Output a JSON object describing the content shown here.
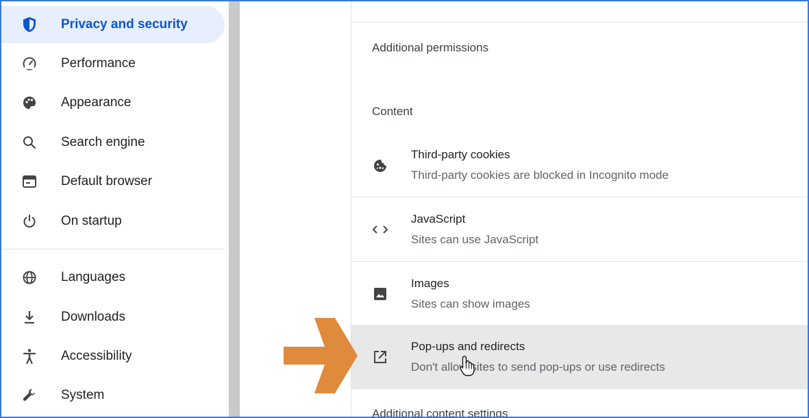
{
  "sidebar": {
    "items": [
      {
        "label": "Privacy and security",
        "icon": "shield-icon",
        "active": true
      },
      {
        "label": "Performance",
        "icon": "speedometer-icon"
      },
      {
        "label": "Appearance",
        "icon": "palette-icon"
      },
      {
        "label": "Search engine",
        "icon": "search-icon"
      },
      {
        "label": "Default browser",
        "icon": "browser-window-icon"
      },
      {
        "label": "On startup",
        "icon": "power-icon"
      },
      {
        "label": "Languages",
        "icon": "globe-icon"
      },
      {
        "label": "Downloads",
        "icon": "download-icon"
      },
      {
        "label": "Accessibility",
        "icon": "accessibility-icon"
      },
      {
        "label": "System",
        "icon": "wrench-icon"
      }
    ]
  },
  "main": {
    "additional_permissions": "Additional permissions",
    "content_heading": "Content",
    "rows": [
      {
        "title": "Third-party cookies",
        "sub": "Third-party cookies are blocked in Incognito mode",
        "icon": "cookie-icon"
      },
      {
        "title": "JavaScript",
        "sub": "Sites can use JavaScript",
        "icon": "code-icon"
      },
      {
        "title": "Images",
        "sub": "Sites can show images",
        "icon": "image-icon"
      },
      {
        "title": "Pop-ups and redirects",
        "sub": "Don't allow sites to send pop-ups or use redirects",
        "icon": "open-in-new-icon",
        "highlighted": true
      }
    ],
    "additional_content_settings": "Additional content settings"
  },
  "colors": {
    "accent": "#0b57d0",
    "active_bg": "#e7eefc",
    "arrow": "#e08a3c",
    "frame": "#3b7ad6"
  }
}
